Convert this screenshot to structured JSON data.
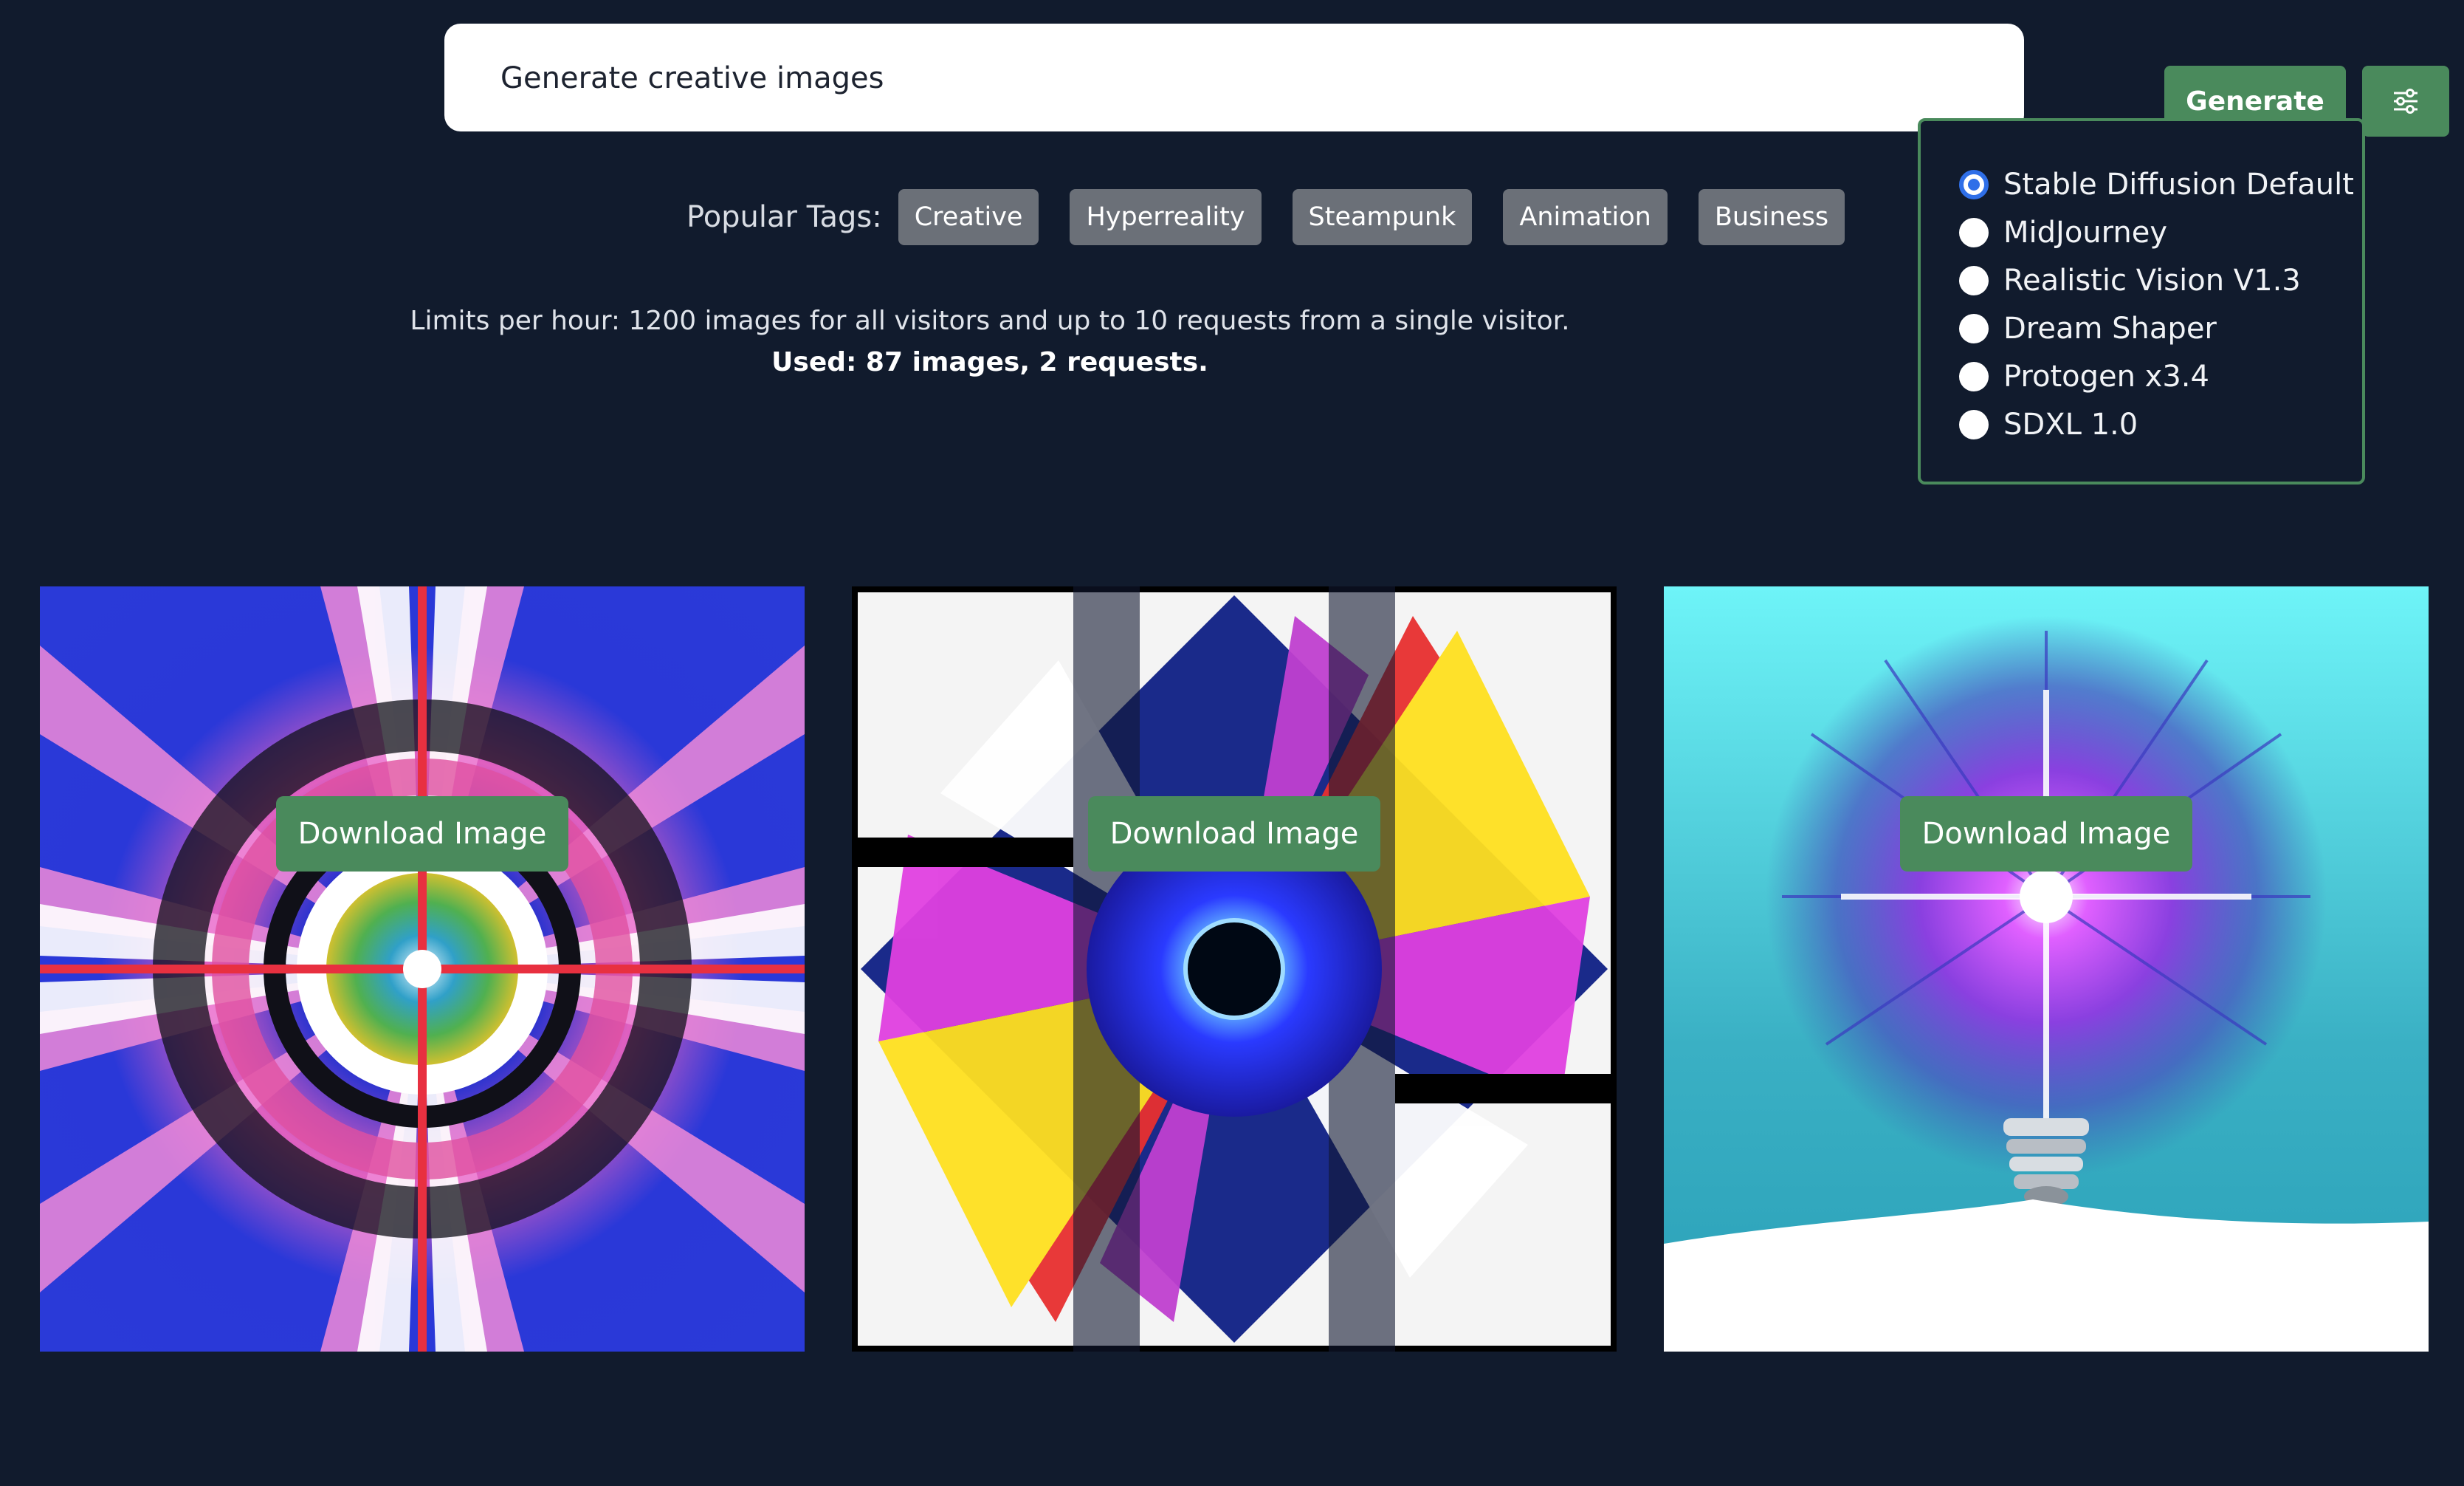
{
  "search": {
    "value": "Generate creative images",
    "generate_label": "Generate",
    "settings_icon": "sliders-icon"
  },
  "models": {
    "selected": "Stable Diffusion Default",
    "options": [
      {
        "label": "Stable Diffusion Default",
        "checked": true
      },
      {
        "label": "MidJourney",
        "checked": false
      },
      {
        "label": "Realistic Vision V1.3",
        "checked": false
      },
      {
        "label": "Dream Shaper",
        "checked": false
      },
      {
        "label": "Protogen x3.4",
        "checked": false
      },
      {
        "label": "SDXL 1.0",
        "checked": false
      }
    ]
  },
  "tags": {
    "label": "Popular Tags:",
    "items": [
      "Creative",
      "Hyperreality",
      "Steampunk",
      "Animation",
      "Business"
    ]
  },
  "limits": {
    "text": "Limits per hour: 1200 images for all visitors and up to 10 requests from a single visitor.",
    "used": "Used: 87 images, 2 requests."
  },
  "gallery": {
    "download_label": "Download Image",
    "images": [
      {
        "subject": "radial-pink-blue-burst"
      },
      {
        "subject": "blue-flower-diamond-abstract"
      },
      {
        "subject": "lightbulb-purple-burst"
      }
    ]
  },
  "colors": {
    "background": "#111b2d",
    "accent_green": "#4a8a5c",
    "tag_gray": "#6b7078",
    "radio_blue": "#2f6fe8"
  }
}
